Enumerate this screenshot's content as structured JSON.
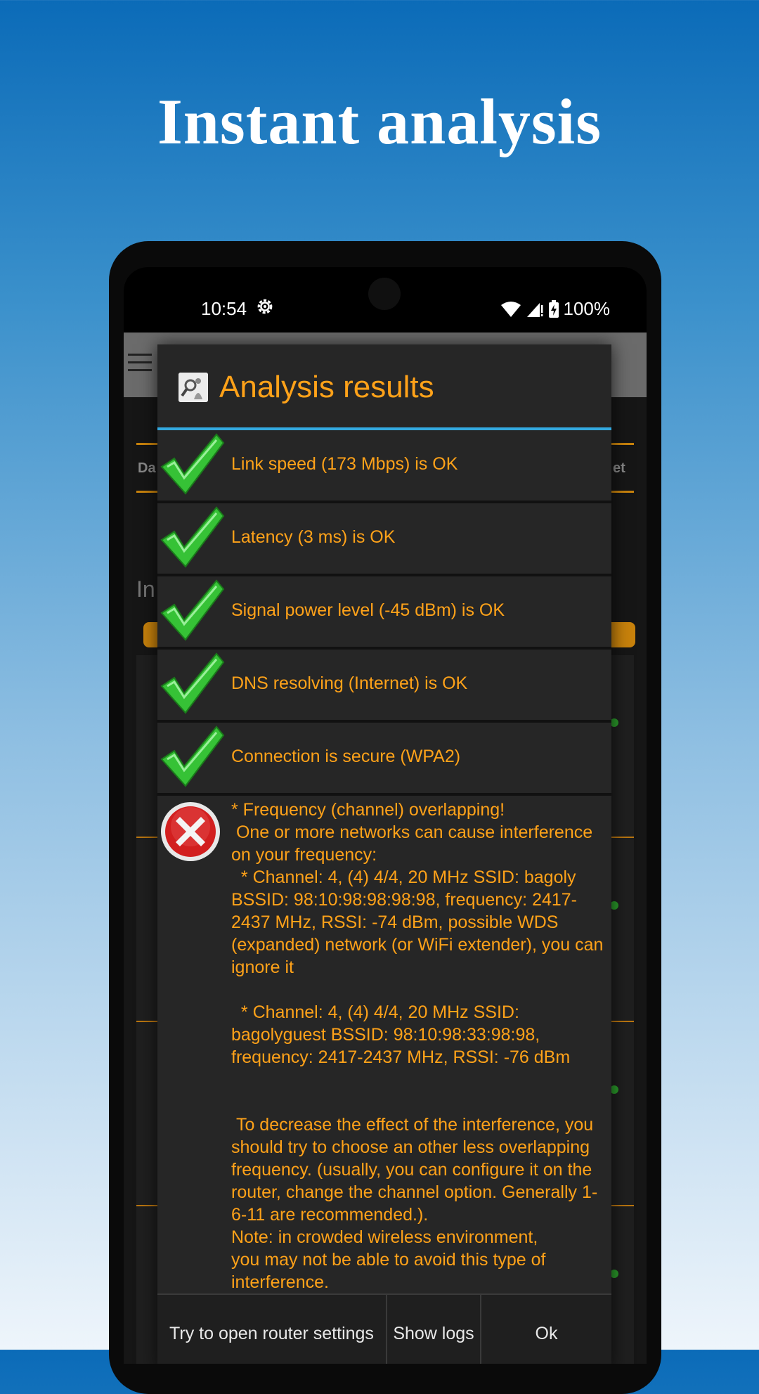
{
  "headline": "Instant analysis",
  "status_bar": {
    "time": "10:54",
    "battery": "100%"
  },
  "dialog": {
    "title": "Analysis results",
    "checks": [
      {
        "status": "ok",
        "text": "Link speed (173 Mbps) is OK"
      },
      {
        "status": "ok",
        "text": "Latency (3 ms) is OK"
      },
      {
        "status": "ok",
        "text": "Signal power level (-45 dBm) is OK"
      },
      {
        "status": "ok",
        "text": "DNS resolving (Internet) is OK"
      },
      {
        "status": "ok",
        "text": "Connection is secure (WPA2)"
      }
    ],
    "warning": {
      "status": "error",
      "text": "* Frequency (channel) overlapping!\n One or more networks can cause interference on your frequency:\n  * Channel: 4, (4) 4/4, 20 MHz SSID: bagoly BSSID: 98:10:98:98:98:98, frequency: 2417-2437 MHz, RSSI: -74 dBm, possible WDS (expanded) network (or WiFi extender), you can ignore it\n\n  * Channel: 4, (4) 4/4, 20 MHz SSID: bagolyguest BSSID: 98:10:98:33:98:98, frequency: 2417-2437 MHz, RSSI: -76 dBm\n\n\n To decrease the effect of the interference, you should try to choose an other less overlapping frequency. (usually, you can configure it on the router, change the channel option. Generally 1-6-11 are recommended.).\nNote: in crowded wireless environment,\nyou may not be able to avoid this type of interference."
    },
    "buttons": {
      "router": "Try to open router settings",
      "logs": "Show logs",
      "ok": "Ok"
    }
  },
  "background": {
    "tab_left": "Da",
    "tab_right": "et",
    "section_label": "In"
  },
  "colors": {
    "accent": "#ffa219",
    "divider": "#33a9e0",
    "ok": "#2fbf2f",
    "error": "#d21f1f"
  }
}
